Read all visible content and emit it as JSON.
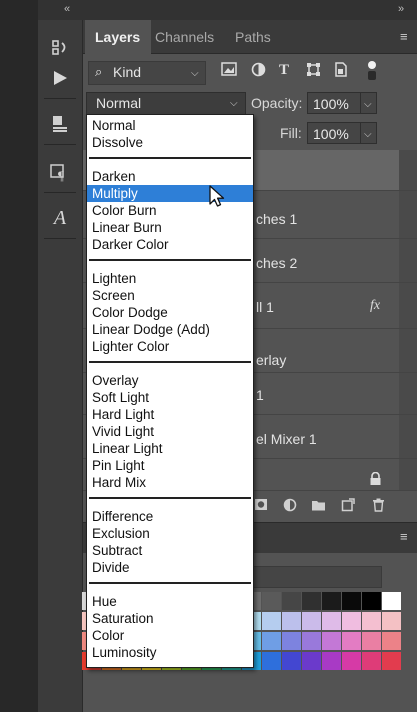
{
  "tabs": [
    "Layers",
    "Channels",
    "Paths"
  ],
  "filter": {
    "kind_label": "Kind",
    "search_glyph": "⌕"
  },
  "blend": {
    "current": "Normal",
    "opacity_label": "Opacity:",
    "opacity_value": "100%",
    "fill_label": "Fill:",
    "fill_value": "100%"
  },
  "layers": [
    "ches 1",
    "ches 2",
    "ll 1",
    "erlay",
    "1",
    "el Mixer 1"
  ],
  "fx_label": "fx",
  "dropdown": {
    "groups": [
      [
        "Normal",
        "Dissolve"
      ],
      [
        "Darken",
        "Multiply",
        "Color Burn",
        "Linear Burn",
        "Darker Color"
      ],
      [
        "Lighten",
        "Screen",
        "Color Dodge",
        "Linear Dodge (Add)",
        "Lighter Color"
      ],
      [
        "Overlay",
        "Soft Light",
        "Hard Light",
        "Vivid Light",
        "Linear Light",
        "Pin Light",
        "Hard Mix"
      ],
      [
        "Difference",
        "Exclusion",
        "Subtract",
        "Divide"
      ],
      [
        "Hue",
        "Saturation",
        "Color",
        "Luminosity"
      ]
    ],
    "highlighted": "Multiply"
  },
  "colors": {
    "highlight": "#2e7fd7",
    "panel_bg": "#535353",
    "tab_bg": "#3a3a3a"
  },
  "icons": [
    "collapse-icon",
    "history-icon",
    "play-icon",
    "properties-icon",
    "paragraph-style-icon",
    "character-icon",
    "image-filter-icon",
    "adjustment-filter-icon",
    "type-filter-icon",
    "shape-filter-icon",
    "smart-object-filter-icon",
    "filter-toggle-icon",
    "panel-menu-icon",
    "fx-icon",
    "lock-icon",
    "trash-icon",
    "new-layer-icon",
    "folder-icon",
    "mask-icon",
    "cursor-icon"
  ]
}
